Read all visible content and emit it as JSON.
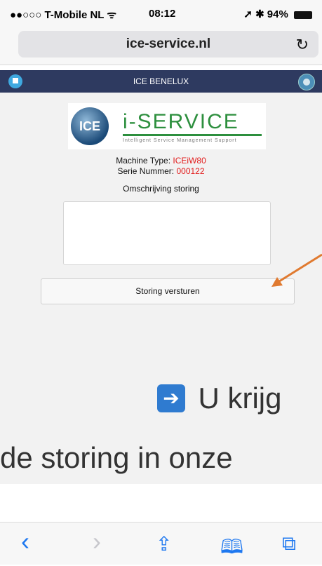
{
  "status_bar": {
    "carrier": "●●○○○ T-Mobile NL ᯤ",
    "time": "08:12",
    "right": "➚ ✱ 94%"
  },
  "browser": {
    "url": "ice-service.nl"
  },
  "app": {
    "header_title": "ICE BENELUX",
    "logo": {
      "badge": "ICE",
      "title": "i-SERVICE",
      "subtitle": "Intelligent Service Management Support"
    },
    "machine_type_label": "Machine Type:",
    "machine_type_value": "ICEiW80",
    "serial_label": "Serie Nummer:",
    "serial_value": "000122",
    "description_label": "Omschrijving storing",
    "description_value": "",
    "submit_label": "Storing versturen"
  },
  "overlay": {
    "line1": "U krijg",
    "line2": "de storing in onze"
  },
  "colors": {
    "header_bg": "#2e3a60",
    "accent_red": "#e21b1b",
    "logo_green": "#2d8f3e",
    "ios_blue": "#1e78f0",
    "annotation_arrow": "#e07a30"
  },
  "toolbar": {
    "back_icon": "‹",
    "forward_icon": "›",
    "share_icon": "⇪",
    "bookmarks_icon": "🕮",
    "tabs_icon": "⧉"
  }
}
